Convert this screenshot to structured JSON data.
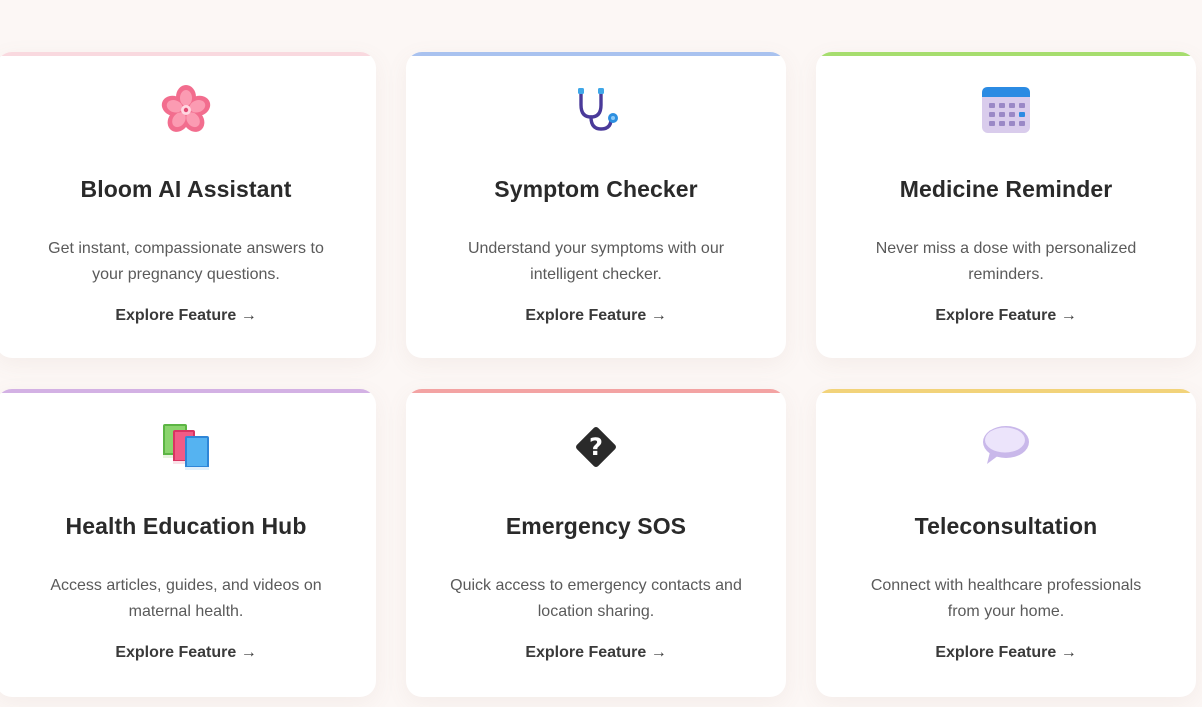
{
  "features": [
    {
      "title": "Bloom AI Assistant",
      "description": "Get instant, compassionate answers to your pregnancy questions.",
      "link": "Explore Feature →",
      "accent": "#f9d9df",
      "icon": "cherry-blossom-icon"
    },
    {
      "title": "Symptom Checker",
      "description": "Understand your symptoms with our intelligent checker.",
      "link": "Explore Feature →",
      "accent": "#a9c2ef",
      "icon": "stethoscope-icon"
    },
    {
      "title": "Medicine Reminder",
      "description": "Never miss a dose with personalized reminders.",
      "link": "Explore Feature →",
      "accent": "#a6dd6e",
      "icon": "calendar-icon"
    },
    {
      "title": "Health Education Hub",
      "description": "Access articles, guides, and videos on maternal health.",
      "link": "Explore Feature →",
      "accent": "#d3b1e4",
      "icon": "books-icon"
    },
    {
      "title": "Emergency SOS",
      "description": "Quick access to emergency contacts and location sharing.",
      "link": "Explore Feature →",
      "accent": "#f3a3a3",
      "icon": "missing-glyph-icon"
    },
    {
      "title": "Teleconsultation",
      "description": "Connect with healthcare professionals from your home.",
      "link": "Explore Feature →",
      "accent": "#f2d37a",
      "icon": "speech-bubble-icon"
    }
  ]
}
